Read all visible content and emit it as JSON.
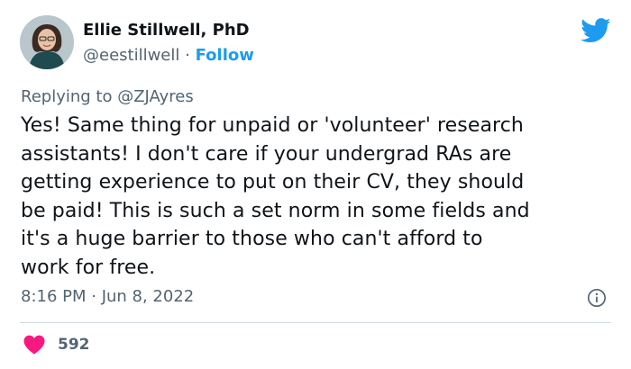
{
  "author": {
    "name": "Ellie Stillwell, PhD",
    "handle": "@eestillwell",
    "separator": "·",
    "follow_label": "Follow"
  },
  "reply": {
    "prefix": "Replying to",
    "mention": "@ZJAyres"
  },
  "tweet": {
    "lines": [
      "Yes! Same thing for unpaid or 'volunteer' research",
      "assistants! I don't care if your undergrad RAs are",
      "getting experience to put on their CV, they should",
      "be paid! This is such a set norm in some fields and",
      "it's a huge barrier to those who can't afford to",
      "work for free."
    ],
    "timestamp": "8:16 PM · Jun 8, 2022"
  },
  "engagement": {
    "likes": "592"
  },
  "icons": {
    "logo": "twitter-bird-icon",
    "info": "info-icon",
    "like": "heart-icon"
  },
  "colors": {
    "brand_blue": "#1d9bf0",
    "heart_pink": "#f91880",
    "text_primary": "#0f1419",
    "text_secondary": "#536471"
  }
}
